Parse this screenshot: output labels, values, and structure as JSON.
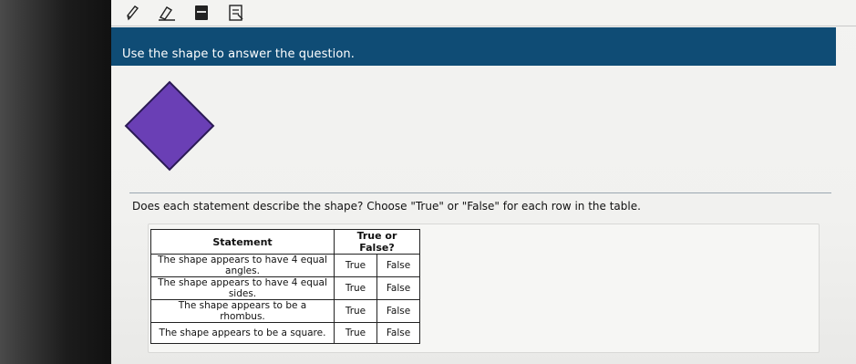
{
  "prompt": "Use the shape to answer the question.",
  "shape": {
    "fill": "#6a3fb5",
    "stroke": "#2b1a55"
  },
  "question": "Does each statement describe the shape? Choose \"True\" or \"False\" for each row in the table.",
  "table": {
    "headers": [
      "Statement",
      "True or False?"
    ],
    "rows": [
      {
        "statement": "The shape appears to have 4 equal angles.",
        "true": "True",
        "false": "False"
      },
      {
        "statement": "The shape appears to have 4 equal sides.",
        "true": "True",
        "false": "False"
      },
      {
        "statement": "The shape appears to be a rhombus.",
        "true": "True",
        "false": "False"
      },
      {
        "statement": "The shape appears to be a square.",
        "true": "True",
        "false": "False"
      }
    ]
  },
  "toolbar": {
    "icons": [
      "pencil-icon",
      "eraser-icon",
      "calculator-icon",
      "notepad-icon"
    ]
  },
  "colors": {
    "prompt_bar": "#0f4c75",
    "shape_fill": "#6a3fb5"
  }
}
